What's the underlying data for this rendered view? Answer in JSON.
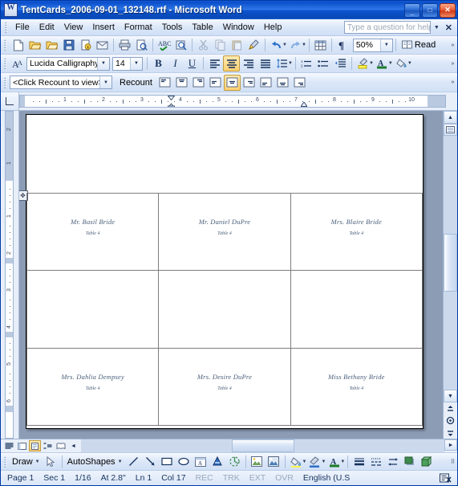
{
  "window": {
    "title": "TentCards_2006-09-01_132148.rtf - Microsoft Word",
    "app_icon": "word-document-icon",
    "minimize_label": "_",
    "maximize_label": "□",
    "close_label": "✕"
  },
  "menubar": {
    "items": [
      {
        "label": "File"
      },
      {
        "label": "Edit"
      },
      {
        "label": "View"
      },
      {
        "label": "Insert"
      },
      {
        "label": "Format"
      },
      {
        "label": "Tools"
      },
      {
        "label": "Table"
      },
      {
        "label": "Window"
      },
      {
        "label": "Help"
      }
    ],
    "ask_placeholder": "Type a question for help",
    "ask_value": "",
    "close_label": "✕"
  },
  "standard_toolbar": {
    "buttons": [
      {
        "name": "new-blank-document-icon",
        "label": "New"
      },
      {
        "name": "open-icon",
        "label": "Open"
      },
      {
        "name": "save-icon",
        "label": "Save"
      },
      {
        "name": "permission-icon",
        "label": "Permission"
      },
      {
        "name": "email-icon",
        "label": "E-mail"
      },
      {
        "name": "print-icon",
        "label": "Print"
      },
      {
        "name": "print-preview-icon",
        "label": "Print Preview"
      },
      {
        "name": "spelling-grammar-icon",
        "label": "Spelling and Grammar"
      },
      {
        "name": "research-icon",
        "label": "Research"
      },
      {
        "name": "cut-icon",
        "label": "Cut"
      },
      {
        "name": "copy-icon",
        "label": "Copy"
      },
      {
        "name": "paste-icon",
        "label": "Paste"
      },
      {
        "name": "format-painter-icon",
        "label": "Format Painter"
      },
      {
        "name": "undo-icon",
        "label": "Undo"
      },
      {
        "name": "redo-icon",
        "label": "Redo"
      },
      {
        "name": "insert-table-icon",
        "label": "Insert Table"
      },
      {
        "name": "show-formatting-icon",
        "label": "Show/Hide ¶"
      }
    ],
    "zoom_value": "50%",
    "read_label": "Read",
    "read_icon": "read-mode-icon",
    "overflow_label": "»"
  },
  "formatting_toolbar": {
    "styles_icon": "styles-and-formatting-icon",
    "font_name": "Lucida Calligraphy",
    "font_size": "14",
    "bold_label": "B",
    "italic_label": "I",
    "underline_label": "U",
    "align_left_icon": "align-left-icon",
    "align_center_icon": "align-center-icon",
    "align_right_icon": "align-right-icon",
    "align_justify_icon": "align-justify-icon",
    "line_spacing_icon": "line-spacing-icon",
    "numbering_icon": "numbered-list-icon",
    "bullets_icon": "bulleted-list-icon",
    "indent_icon": "decrease-indent-icon",
    "highlight_icon": "highlight-color-icon",
    "font_color_icon": "font-color-icon",
    "shading_icon": "shading-color-icon",
    "overflow_label": "»"
  },
  "wordcount_toolbar": {
    "count_value": "<Click Recount to view>",
    "recount_label": "Recount",
    "cell_align_buttons": [
      {
        "name": "align-top-left-icon"
      },
      {
        "name": "align-top-center-icon"
      },
      {
        "name": "align-top-right-icon"
      },
      {
        "name": "align-center-left-icon"
      },
      {
        "name": "align-center-icon",
        "active": true
      },
      {
        "name": "align-center-right-icon"
      },
      {
        "name": "align-bottom-left-icon"
      },
      {
        "name": "align-bottom-center-icon"
      },
      {
        "name": "align-bottom-right-icon"
      }
    ],
    "overflow_label": "»"
  },
  "ruler": {
    "tab_selector_icon": "left-tab-stop-icon",
    "h_numbers": [
      "1",
      "2",
      "3",
      "4",
      "5",
      "6",
      "7",
      "8",
      "9",
      "10"
    ],
    "v_numbers": [
      "2",
      "1",
      "1",
      "2",
      "3",
      "4",
      "5",
      "6"
    ]
  },
  "document": {
    "table_move_handle_icon": "table-move-handle-icon",
    "cards": [
      {
        "name": "Mr. Basil Bride",
        "table": "Table 4"
      },
      {
        "name": "Mr. Daniel DuPre",
        "table": "Table 4"
      },
      {
        "name": "Mrs. Blaire Bride",
        "table": "Table 4"
      },
      {
        "name": "",
        "table": ""
      },
      {
        "name": "",
        "table": ""
      },
      {
        "name": "",
        "table": ""
      },
      {
        "name": "Mrs. Dahlia Dempsey",
        "table": "Table 4"
      },
      {
        "name": "Mrs. Desire DuPre",
        "table": "Table 4"
      },
      {
        "name": "Miss Bethany Bride",
        "table": "Table 4"
      }
    ],
    "text_color": "#4a5f7a"
  },
  "scrollbars": {
    "up_arrow": "▲",
    "down_arrow": "▼",
    "left_arrow": "◄",
    "right_arrow": "►",
    "prev_page_icon": "previous-page-icon",
    "select_object_icon": "select-browse-object-icon",
    "next_page_icon": "next-page-icon"
  },
  "view_bar": {
    "buttons": [
      {
        "name": "normal-view-icon",
        "label": "Normal"
      },
      {
        "name": "web-layout-view-icon",
        "label": "Web Layout"
      },
      {
        "name": "print-layout-view-icon",
        "label": "Print Layout",
        "active": true
      },
      {
        "name": "outline-view-icon",
        "label": "Outline"
      },
      {
        "name": "reading-layout-view-icon",
        "label": "Reading Layout"
      }
    ]
  },
  "drawing_toolbar": {
    "draw_label": "Draw",
    "select_objects_icon": "select-objects-icon",
    "autoshapes_label": "AutoShapes",
    "buttons": [
      {
        "name": "line-icon"
      },
      {
        "name": "arrow-icon"
      },
      {
        "name": "rectangle-icon"
      },
      {
        "name": "oval-icon"
      },
      {
        "name": "text-box-icon"
      },
      {
        "name": "wordart-icon"
      },
      {
        "name": "diagram-icon"
      },
      {
        "name": "clip-art-icon"
      },
      {
        "name": "picture-icon"
      },
      {
        "name": "fill-color-icon"
      },
      {
        "name": "line-color-icon"
      },
      {
        "name": "font-color-icon"
      },
      {
        "name": "line-style-icon"
      },
      {
        "name": "dash-style-icon"
      },
      {
        "name": "arrow-style-icon"
      },
      {
        "name": "shadow-style-icon"
      },
      {
        "name": "3d-style-icon"
      }
    ]
  },
  "statusbar": {
    "page": "Page  1",
    "section": "Sec  1",
    "pages": "1/16",
    "at": "At 2.8\"",
    "line": "Ln 1",
    "column": "Col  17",
    "rec": "REC",
    "trk": "TRK",
    "ext": "EXT",
    "ovr": "OVR",
    "language": "English (U.S",
    "spell_icon": "spelling-status-icon"
  }
}
